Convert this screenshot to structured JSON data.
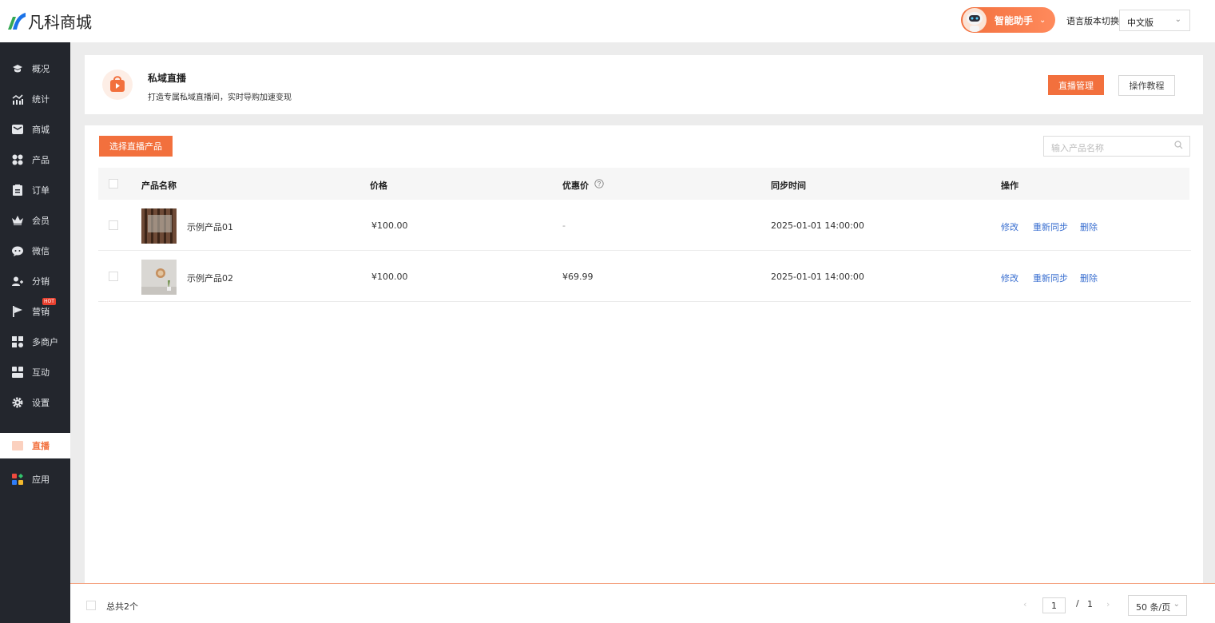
{
  "brand": {
    "name": "凡科商城"
  },
  "topbar": {
    "assistant_label": "智能助手",
    "language_label": "语言版本切换：",
    "language_value": "中文版"
  },
  "sidebar": {
    "items": [
      {
        "label": "概况",
        "icon": "graduation-cap-icon"
      },
      {
        "label": "统计",
        "icon": "chart-icon"
      },
      {
        "label": "商城",
        "icon": "store-icon"
      },
      {
        "label": "产品",
        "icon": "grid-icon"
      },
      {
        "label": "订单",
        "icon": "clipboard-icon"
      },
      {
        "label": "会员",
        "icon": "crown-icon"
      },
      {
        "label": "微信",
        "icon": "wechat-icon"
      },
      {
        "label": "分销",
        "icon": "users-icon"
      },
      {
        "label": "营销",
        "icon": "flag-icon",
        "badge": "HOT"
      },
      {
        "label": "多商户",
        "icon": "shop-icon"
      },
      {
        "label": "互动",
        "icon": "blocks-icon"
      },
      {
        "label": "设置",
        "icon": "gear-icon"
      },
      {
        "label": "直播",
        "icon": "live-icon",
        "active": true
      },
      {
        "label": "应用",
        "icon": "apps-icon"
      }
    ]
  },
  "header_card": {
    "title": "私域直播",
    "description": "打造专属私域直播间，实时导购加速变现",
    "manage_button": "直播管理",
    "tutorial_button": "操作教程"
  },
  "toolbar": {
    "select_button": "选择直播产品",
    "search_placeholder": "输入产品名称"
  },
  "table": {
    "columns": [
      "产品名称",
      "价格",
      "优惠价",
      "同步时间",
      "操作"
    ],
    "rows": [
      {
        "name": "示例产品01",
        "price": "¥100.00",
        "discount": "-",
        "sync_time": "2025-01-01 14:00:00",
        "actions": [
          "修改",
          "重新同步",
          "删除"
        ]
      },
      {
        "name": "示例产品02",
        "price": "¥100.00",
        "discount": "¥69.99",
        "sync_time": "2025-01-01 14:00:00",
        "actions": [
          "修改",
          "重新同步",
          "删除"
        ]
      }
    ]
  },
  "footer": {
    "total": "总共2个",
    "current_page": "1",
    "page_sep": "/",
    "total_pages": "1",
    "page_size": "50 条/页"
  },
  "colors": {
    "accent": "#f2703d",
    "sidebar_bg": "#23262d",
    "link": "#3a6fd0"
  }
}
